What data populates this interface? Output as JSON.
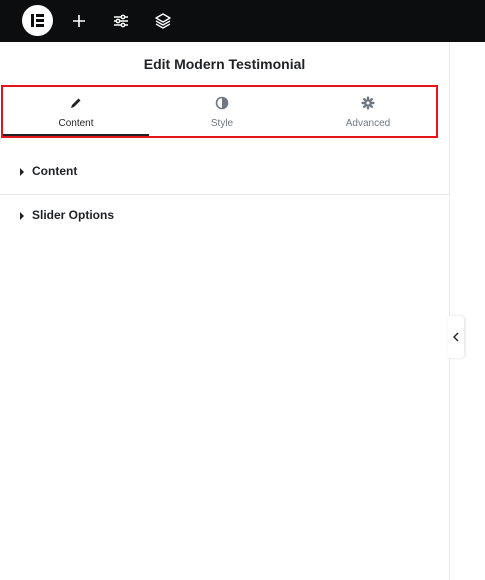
{
  "topbar": {
    "logo_icon": "elementor-logo-icon",
    "add_icon": "plus-icon",
    "settings_icon": "sliders-icon",
    "structure_icon": "layers-icon"
  },
  "panel": {
    "title": "Edit Modern Testimonial",
    "tabs": [
      {
        "label": "Content",
        "icon": "pencil-icon",
        "active": true
      },
      {
        "label": "Style",
        "icon": "half-circle-icon",
        "active": false
      },
      {
        "label": "Advanced",
        "icon": "gear-icon",
        "active": false
      }
    ],
    "sections": [
      {
        "label": "Content"
      },
      {
        "label": "Slider Options"
      }
    ]
  },
  "collapse_icon": "chevron-left-icon",
  "colors": {
    "topbar": "#0c0d0e",
    "highlight": "#e5131a",
    "text": "#1f2124",
    "muted": "#6d7882"
  }
}
